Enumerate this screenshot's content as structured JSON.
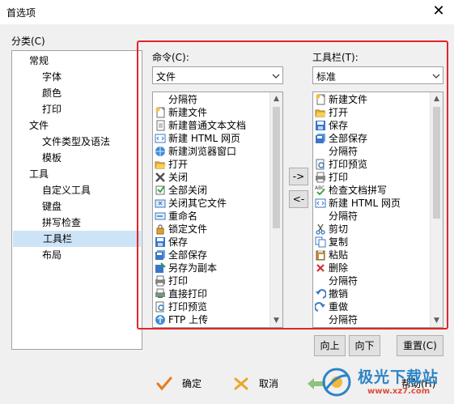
{
  "window": {
    "title": "首选项",
    "close_glyph": "✕"
  },
  "category": {
    "label": "分类(C)",
    "items": [
      {
        "label": "常规"
      },
      {
        "label": "字体"
      },
      {
        "label": "颜色"
      },
      {
        "label": "打印"
      },
      {
        "label": "文件"
      },
      {
        "label": "文件类型及语法"
      },
      {
        "label": "模板"
      },
      {
        "label": "工具"
      },
      {
        "label": "自定义工具"
      },
      {
        "label": "键盘"
      },
      {
        "label": "拼写检查"
      },
      {
        "label": "工具栏"
      },
      {
        "label": "布局"
      }
    ],
    "selected": "工具栏"
  },
  "commands": {
    "label": "命令(C):",
    "combo_value": "文件",
    "items": [
      {
        "icon": "none",
        "label": "分隔符"
      },
      {
        "icon": "new-file-icon",
        "label": "新建文件"
      },
      {
        "icon": "new-text-doc-icon",
        "label": "新建普通文本文档"
      },
      {
        "icon": "html-page-icon",
        "label": "新建 HTML 网页"
      },
      {
        "icon": "browser-window-icon",
        "label": "新建浏览器窗口"
      },
      {
        "icon": "open-folder-icon",
        "label": "打开"
      },
      {
        "icon": "close-x-icon",
        "label": "关闭"
      },
      {
        "icon": "close-all-icon",
        "label": "全部关闭"
      },
      {
        "icon": "close-others-icon",
        "label": "关闭其它文件"
      },
      {
        "icon": "rename-icon",
        "label": "重命名"
      },
      {
        "icon": "lock-icon",
        "label": "锁定文件"
      },
      {
        "icon": "save-icon",
        "label": "保存"
      },
      {
        "icon": "save-all-icon",
        "label": "全部保存"
      },
      {
        "icon": "save-copy-icon",
        "label": "另存为副本"
      },
      {
        "icon": "print-icon",
        "label": "打印"
      },
      {
        "icon": "direct-print-icon",
        "label": "直接打印"
      },
      {
        "icon": "print-preview-icon",
        "label": "打印预览"
      },
      {
        "icon": "ftp-upload-icon",
        "label": "FTP 上传"
      }
    ]
  },
  "toolbar": {
    "label": "工具栏(T):",
    "combo_value": "标准",
    "items": [
      {
        "icon": "new-file-icon",
        "label": "新建文件"
      },
      {
        "icon": "open-folder-icon",
        "label": "打开"
      },
      {
        "icon": "save-icon",
        "label": "保存"
      },
      {
        "icon": "save-all-icon",
        "label": "全部保存"
      },
      {
        "icon": "none",
        "label": "分隔符"
      },
      {
        "icon": "print-preview-icon",
        "label": "打印预览"
      },
      {
        "icon": "print-icon",
        "label": "打印"
      },
      {
        "icon": "spellcheck-icon",
        "label": "检查文档拼写"
      },
      {
        "icon": "html-page-icon",
        "label": "新建 HTML 网页"
      },
      {
        "icon": "none",
        "label": "分隔符"
      },
      {
        "icon": "cut-icon",
        "label": "剪切"
      },
      {
        "icon": "copy-icon",
        "label": "复制"
      },
      {
        "icon": "paste-icon",
        "label": "粘贴"
      },
      {
        "icon": "delete-icon",
        "label": "删除"
      },
      {
        "icon": "none",
        "label": "分隔符"
      },
      {
        "icon": "undo-icon",
        "label": "撤销"
      },
      {
        "icon": "redo-icon",
        "label": "重做"
      },
      {
        "icon": "none",
        "label": "分隔符"
      }
    ]
  },
  "transfer": {
    "add": "->",
    "remove": "<-"
  },
  "actions": {
    "up": "向上",
    "down": "向下",
    "reset": "重置(C)"
  },
  "footer": {
    "ok": "确定",
    "cancel": "取消",
    "help": "帮助(H)"
  },
  "watermark": {
    "brand": "极光下载站",
    "url": "www.xz7.com"
  },
  "colors": {
    "highlight": "#e0262b",
    "selection": "#cde3f7"
  }
}
